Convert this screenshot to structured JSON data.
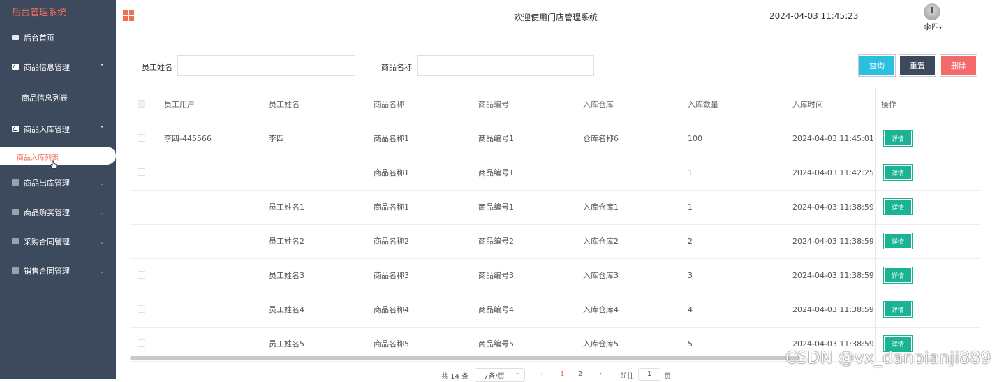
{
  "brand": "后台管理系统",
  "header": {
    "title": "欢迎使用门店管理系统",
    "datetime": "2024-04-03 11:45:23",
    "user": "李四",
    "user_caret": "▾"
  },
  "sidebar": {
    "home": "后台首页",
    "product_info": "商品信息管理",
    "product_info_list": "商品信息列表",
    "stock_in": "商品入库管理",
    "stock_in_list": "商品入库列表",
    "stock_out": "商品出库管理",
    "purchase": "商品购买管理",
    "purchase_contract": "采购合同管理",
    "sales_contract": "销售合同管理",
    "arrow_up": "⌃",
    "arrow_down": "⌄"
  },
  "search": {
    "employee_label": "员工姓名",
    "employee_value": "",
    "product_label": "商品名称",
    "product_value": "",
    "query_btn": "查询",
    "reset_btn": "重置",
    "delete_btn": "删除"
  },
  "colors": {
    "accent": "#f06e5a",
    "sidebar_bg": "#3d4a5d",
    "query": "#2bbfe0",
    "reset": "#3d4a5d",
    "delete": "#f46a6a",
    "detail": "#1ab394"
  },
  "table": {
    "headers": [
      "员工用户",
      "员工姓名",
      "商品名称",
      "商品编号",
      "入库仓库",
      "入库数量",
      "入库时间",
      "操作"
    ],
    "detail_label": "详情",
    "rows": [
      [
        "李四-445566",
        "李四",
        "商品名称1",
        "商品编号1",
        "仓库名称6",
        "100",
        "2024-04-03 11:45:01"
      ],
      [
        "",
        "",
        "商品名称1",
        "商品编号1",
        "",
        "1",
        "2024-04-03 11:42:25"
      ],
      [
        "",
        "员工姓名1",
        "商品名称1",
        "商品编号1",
        "入库仓库1",
        "1",
        "2024-04-03 11:38:59"
      ],
      [
        "",
        "员工姓名2",
        "商品名称2",
        "商品编号2",
        "入库仓库2",
        "2",
        "2024-04-03 11:38:59"
      ],
      [
        "",
        "员工姓名3",
        "商品名称3",
        "商品编号3",
        "入库仓库3",
        "3",
        "2024-04-03 11:38:59"
      ],
      [
        "",
        "员工姓名4",
        "商品名称4",
        "商品编号4",
        "入库仓库4",
        "4",
        "2024-04-03 11:38:59"
      ],
      [
        "",
        "员工姓名5",
        "商品名称5",
        "商品编号5",
        "入库仓库5",
        "5",
        "2024-04-03 11:38:59"
      ]
    ]
  },
  "pager": {
    "total": "共 14 条",
    "page_size": "7条/页",
    "page_size_caret": "⌄",
    "prev": "‹",
    "pages": [
      "1",
      "2"
    ],
    "next": "›",
    "goto_label": "前往",
    "goto_value": "1",
    "goto_suffix": "页"
  },
  "watermark": "CSDN @vx_danpianji889"
}
